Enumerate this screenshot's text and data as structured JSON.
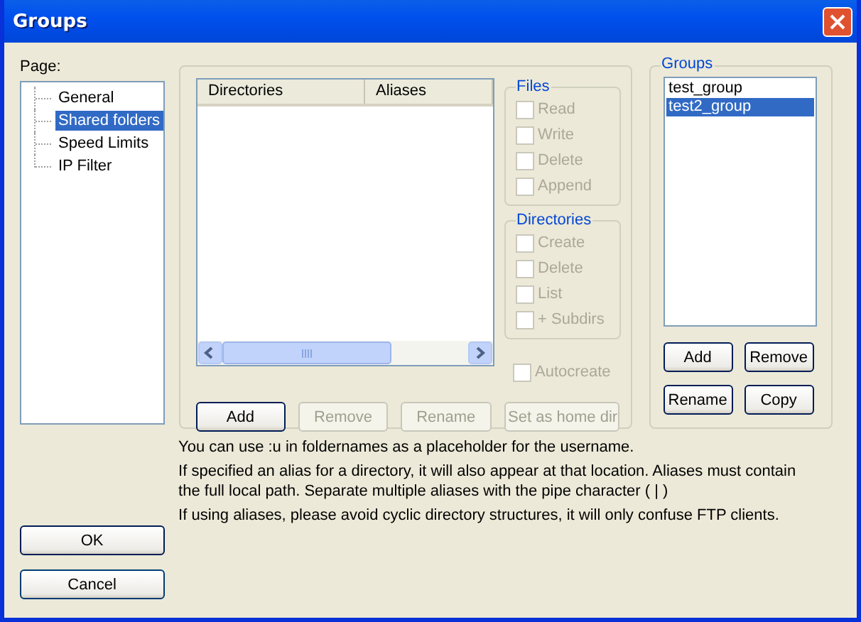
{
  "window": {
    "title": "Groups"
  },
  "page_label": "Page:",
  "pages": [
    {
      "label": "General",
      "selected": false
    },
    {
      "label": "Shared folders",
      "selected": true
    },
    {
      "label": "Speed Limits",
      "selected": false
    },
    {
      "label": "IP Filter",
      "selected": false
    }
  ],
  "folders": {
    "columns": [
      "Directories",
      "Aliases"
    ],
    "buttons": [
      {
        "label": "Add",
        "disabled": false
      },
      {
        "label": "Remove",
        "disabled": true
      },
      {
        "label": "Rename",
        "disabled": true
      },
      {
        "label": "Set as home dir",
        "disabled": true
      }
    ]
  },
  "files": {
    "title": "Files",
    "options": [
      {
        "label": "Read",
        "checked": false,
        "disabled": true
      },
      {
        "label": "Write",
        "checked": false,
        "disabled": true
      },
      {
        "label": "Delete",
        "checked": false,
        "disabled": true
      },
      {
        "label": "Append",
        "checked": false,
        "disabled": true
      }
    ]
  },
  "directories": {
    "title": "Directories",
    "options": [
      {
        "label": "Create",
        "checked": false,
        "disabled": true
      },
      {
        "label": "Delete",
        "checked": false,
        "disabled": true
      },
      {
        "label": "List",
        "checked": false,
        "disabled": true
      },
      {
        "label": "+ Subdirs",
        "checked": false,
        "disabled": true
      }
    ]
  },
  "autocreate": {
    "label": "Autocreate",
    "checked": false,
    "disabled": true
  },
  "groups": {
    "title": "Groups",
    "items": [
      {
        "label": "test_group",
        "selected": false
      },
      {
        "label": "test2_group",
        "selected": true
      }
    ],
    "buttons": [
      {
        "label": "Add",
        "disabled": false
      },
      {
        "label": "Remove",
        "disabled": false
      },
      {
        "label": "Rename",
        "disabled": false
      },
      {
        "label": "Copy",
        "disabled": false
      }
    ]
  },
  "notes": [
    "You can use :u in foldernames as a placeholder for the username.",
    "If specified an alias for a directory, it will also appear at that location. Aliases must contain the full local path. Separate multiple aliases with the pipe character ( | )",
    "If using aliases, please avoid cyclic directory structures, it will only confuse FTP clients."
  ],
  "buttons": [
    {
      "label": "OK"
    },
    {
      "label": "Cancel"
    }
  ]
}
